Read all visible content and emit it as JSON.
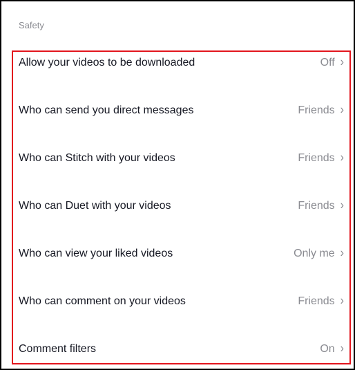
{
  "section": {
    "title": "Safety"
  },
  "highlight_color": "#e2151d",
  "icons": {
    "chevron": "chevron-right-icon"
  },
  "rows": [
    {
      "label": "Allow your videos to be downloaded",
      "value": "Off"
    },
    {
      "label": "Who can send you direct messages",
      "value": "Friends"
    },
    {
      "label": "Who can Stitch with your videos",
      "value": "Friends"
    },
    {
      "label": "Who can Duet with your videos",
      "value": "Friends"
    },
    {
      "label": "Who can view your liked videos",
      "value": "Only me"
    },
    {
      "label": "Who can comment on your videos",
      "value": "Friends"
    },
    {
      "label": "Comment filters",
      "value": "On"
    }
  ]
}
